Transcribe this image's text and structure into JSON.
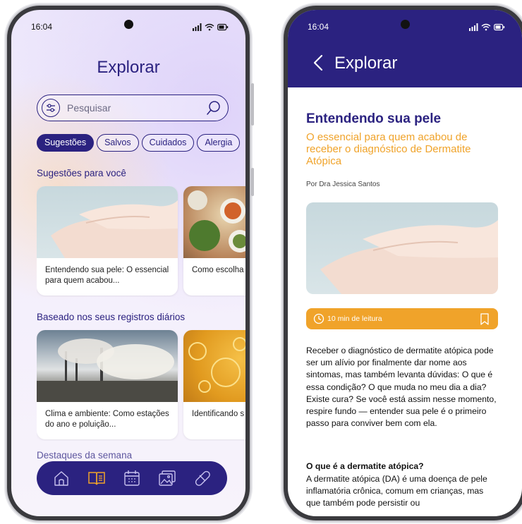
{
  "status_bar": {
    "time": "16:04"
  },
  "explore_screen": {
    "title": "Explorar",
    "search": {
      "placeholder": "Pesquisar"
    },
    "chips": [
      {
        "label": "Sugestões",
        "active": true
      },
      {
        "label": "Salvos",
        "active": false
      },
      {
        "label": "Cuidados",
        "active": false
      },
      {
        "label": "Alergia",
        "active": false
      }
    ],
    "sections": [
      {
        "title": "Sugestões para você",
        "cards": [
          {
            "text": "Entendendo sua pele: O essencial para quem acabou...",
            "image": "hands-cream"
          },
          {
            "text": "Como escolha podem influer",
            "image": "food-bowls"
          }
        ]
      },
      {
        "title": "Baseado nos seus registros diários",
        "cards": [
          {
            "text": "Clima e ambiente: Como estações do ano e poluição...",
            "image": "factory-smoke"
          },
          {
            "text": "Identificando s irritam sua pe",
            "image": "oil-bubbles"
          }
        ]
      }
    ],
    "partial_section_title": "Destaques da semana",
    "bottom_nav": [
      {
        "icon": "home-icon",
        "active": false
      },
      {
        "icon": "book-icon",
        "active": true
      },
      {
        "icon": "calendar-icon",
        "active": false
      },
      {
        "icon": "gallery-icon",
        "active": false
      },
      {
        "icon": "pill-icon",
        "active": false
      }
    ]
  },
  "article_screen": {
    "header_title": "Explorar",
    "title": "Entendendo sua pele",
    "subtitle": "O essencial para quem acabou de receber o diagnóstico de Dermatite Atópica",
    "author": "Por Dra Jessica Santos",
    "read_time": "10 min de leitura",
    "paragraph_1": "Receber o diagnóstico de dermatite atópica pode ser um alívio por finalmente dar nome aos sintomas, mas também levanta dúvidas: O que é essa condição? O que muda no meu dia a dia? Existe cura? Se você está assim nesse momento, respire fundo — entender sua pele é o primeiro passo para conviver bem com ela.",
    "heading_2": "O que é a dermatite atópica?",
    "paragraph_2": "A dermatite atópica (DA) é uma doença de pele inflamatória crônica, comum em crianças, mas que também pode persistir ou"
  },
  "colors": {
    "primary": "#2b2280",
    "accent": "#f0a32a",
    "background_tint": "#ece6fb"
  }
}
